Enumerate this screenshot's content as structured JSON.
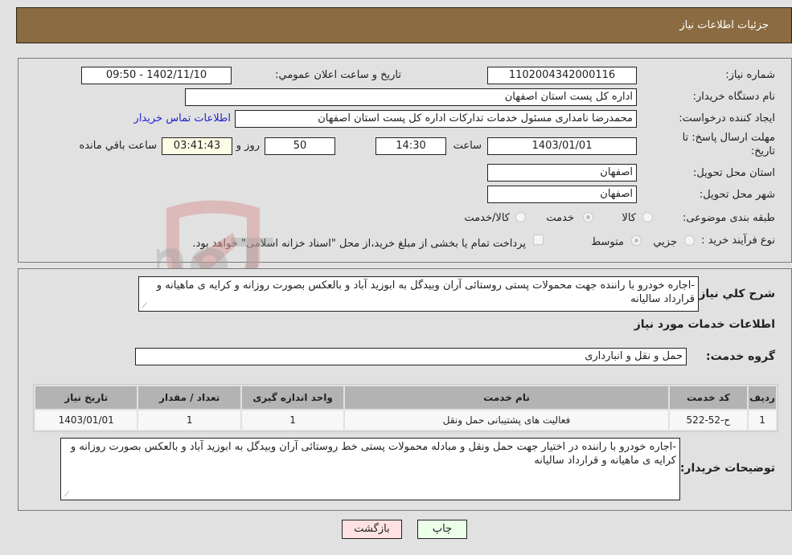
{
  "header": {
    "title": "جزئیات اطلاعات نیاز"
  },
  "details": {
    "need_number": {
      "label": "شماره نیاز:",
      "value": "1102004342000116"
    },
    "announce_datetime": {
      "label": "تاریخ و ساعت اعلان عمومي:",
      "value": "1402/11/10 - 09:50"
    },
    "buyer_org": {
      "label": "نام دستگاه خریدار:",
      "value": "اداره کل پست استان اصفهان"
    },
    "requester": {
      "label": "ایجاد کننده درخواست:",
      "value": "محمدرضا نامداری مسئول خدمات تدارکات اداره کل پست استان اصفهان"
    },
    "buyer_contact_link": "اطلاعات تماس خریدار",
    "deadline": {
      "label_line1": "مهلت ارسال پاسخ: تا",
      "label_line2": "تاریخ:",
      "date": "1403/01/01",
      "time_label": "ساعت",
      "time": "14:30",
      "days": "50",
      "days_label": "روز و",
      "remaining": "03:41:43",
      "remaining_label": "ساعت باقي مانده"
    },
    "delivery_province": {
      "label": "استان محل تحویل:",
      "value": "اصفهان"
    },
    "delivery_city": {
      "label": "شهر محل تحویل:",
      "value": "اصفهان"
    },
    "category": {
      "label": "طبقه بندی موضوعی:",
      "options": [
        "کالا",
        "خدمت",
        "کالا/خدمت"
      ],
      "selected": "خدمت"
    },
    "purchase_type": {
      "label": "نوع فرآیند خرید :",
      "options": [
        "جزيي",
        "متوسط"
      ],
      "selected": "متوسط",
      "treasury_note": "پرداخت تمام یا بخشی از مبلغ خرید،از محل \"اسناد خزانه اسلامی\" خواهد بود.",
      "treasury_checked": false
    }
  },
  "summary": {
    "label": "شرح کلي نیاز:",
    "value": "-اجاره خودرو با راننده جهت  محمولات پستی  روستائی آران وبیدگل به ابوزید آباد و بالعکس بصورت روزانه و کرایه ی ماهیانه و قرارداد سالیانه"
  },
  "services": {
    "title": "اطلاعات خدمات مورد نیاز",
    "group_label": "گروه خدمت:",
    "group_value": "حمل و نقل و انبارداری",
    "columns": [
      "ردیف",
      "کد خدمت",
      "نام خدمت",
      "واحد اندازه گیری",
      "تعداد / مقدار",
      "تاریخ نیاز"
    ],
    "rows": [
      [
        "1",
        "ح-52-522",
        "فعالیت های پشتیبانی حمل ونقل",
        "1",
        "1",
        "1403/01/01"
      ]
    ]
  },
  "buyer_notes": {
    "label": "توضیحات خریدار:",
    "value": "-اجاره خودرو با راننده در اختیار جهت حمل ونقل و مبادله محمولات  پستی خط روستائی آران وبیدگل به ابوزید آباد و بالعکس بصورت روزانه و کرایه ی ماهیانه و قرارداد سالیانه"
  },
  "buttons": {
    "print": "چاپ",
    "back": "بازگشت"
  },
  "watermark": {
    "text": "AriaTender.neT"
  },
  "colors": {
    "header_bg": "#8b6b41",
    "link": "#2222cc",
    "remaining_bg": "#fefee6",
    "print_bg": "#ebffe9",
    "back_bg": "#ffe1e1"
  }
}
